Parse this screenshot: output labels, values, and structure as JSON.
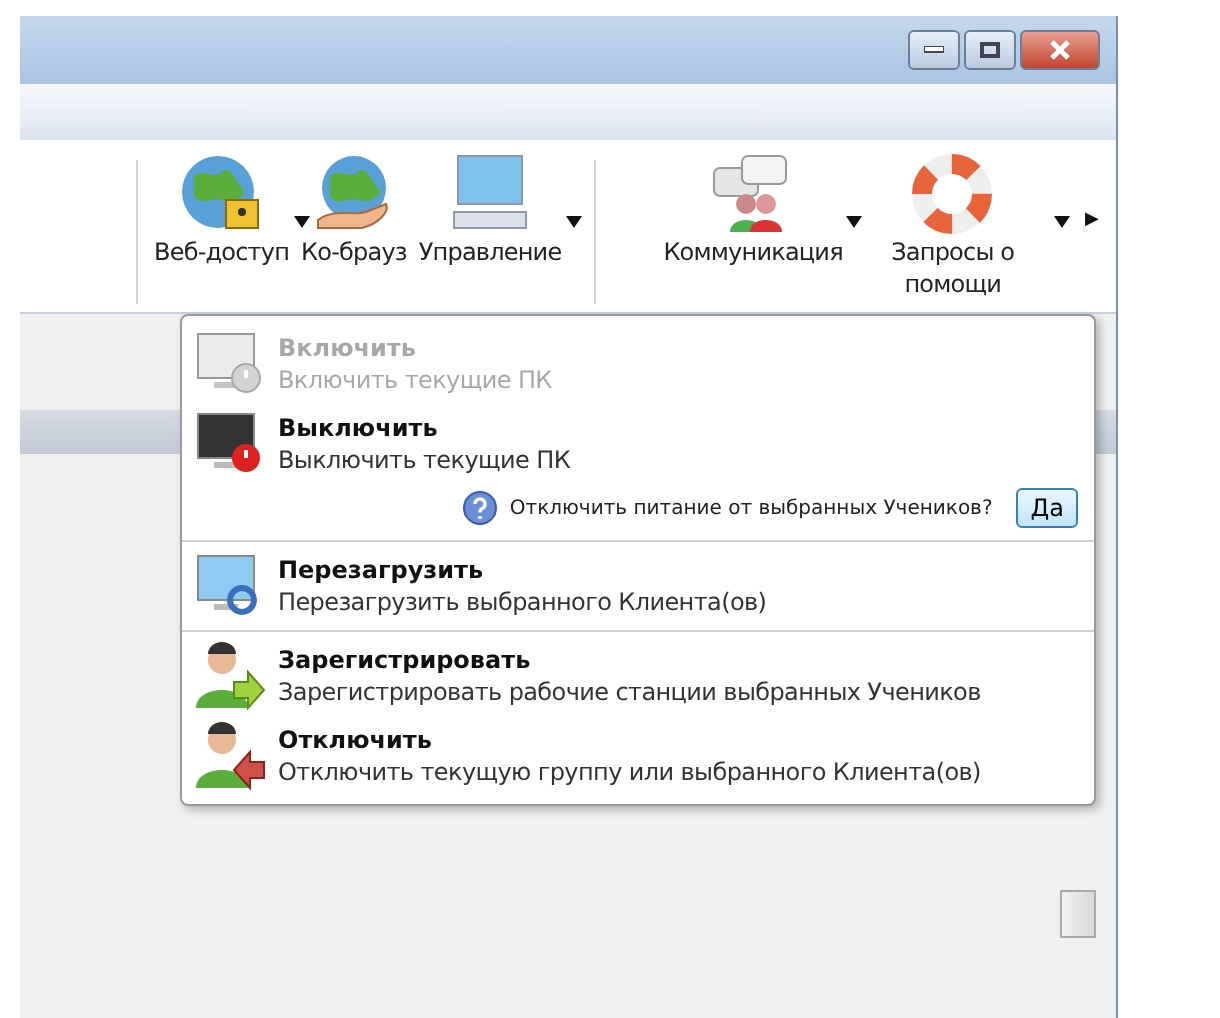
{
  "toolbar": {
    "groups": [
      {
        "items": [
          {
            "label": "Веб-доступ",
            "has_menu": true
          },
          {
            "label": "Ко-брауз",
            "has_menu": false
          },
          {
            "label": "Управление",
            "has_menu": true
          }
        ]
      },
      {
        "items": [
          {
            "label": "Коммуникация",
            "has_menu": true
          },
          {
            "label": "Запросы о помощи",
            "has_menu": true
          }
        ]
      }
    ],
    "more": "▶"
  },
  "menu": {
    "sections": [
      [
        {
          "kind": "command",
          "title": "Включить",
          "description": "Включить текущие ПК",
          "disabled": true
        },
        {
          "kind": "command",
          "title": "Выключить",
          "description": "Выключить текущие ПК",
          "disabled": false
        },
        {
          "kind": "confirm",
          "text": "Отключить питание от выбранных Учеников?",
          "button": "Да"
        }
      ],
      [
        {
          "kind": "command",
          "title": "Перезагрузить",
          "description": "Перезагрузить выбранного Клиента(ов)",
          "disabled": false
        }
      ],
      [
        {
          "kind": "command",
          "title": "Зарегистрировать",
          "description": "Зарегистрировать рабочие станции выбранных Учеников",
          "disabled": false
        },
        {
          "kind": "command",
          "title": "Отключить",
          "description": "Отключить текущую группу или выбранного Клиента(ов)",
          "disabled": false
        }
      ]
    ]
  }
}
